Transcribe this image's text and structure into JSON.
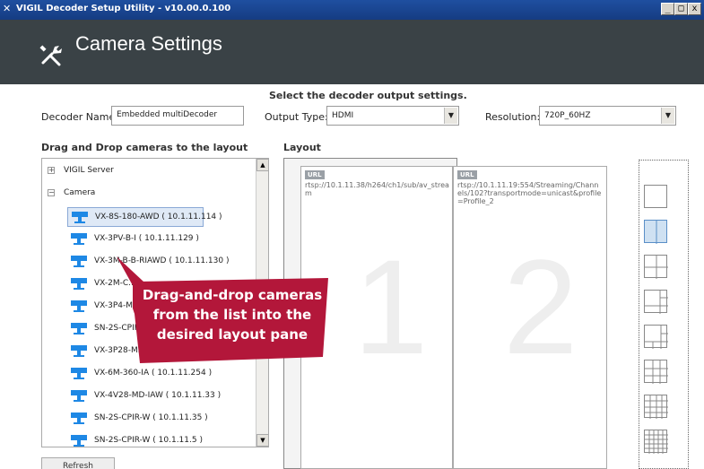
{
  "window": {
    "title": "VIGIL Decoder Setup Utility - v10.00.0.100",
    "minimize_label": "_",
    "maximize_label": "□",
    "close_label": "x"
  },
  "header": {
    "title": "Camera Settings",
    "icon": "wrench-screwdriver-icon"
  },
  "output_settings": {
    "heading": "Select the decoder output settings.",
    "decoder_name_label": "Decoder Name:",
    "decoder_name_value": "Embedded multiDecoder",
    "output_type_label": "Output Type:",
    "output_type_value": "HDMI",
    "resolution_label": "Resolution:",
    "resolution_value": "720P_60HZ"
  },
  "camera_list": {
    "heading": "Drag and Drop cameras to the layout",
    "nodes": [
      {
        "label": "VIGIL Server",
        "expander": "+"
      },
      {
        "label": "Camera",
        "expander": "−"
      }
    ],
    "cameras": [
      {
        "label": "VX-8S-180-AWD ( 10.1.11.114 )",
        "selected": true
      },
      {
        "label": "VX-3PV-B-I ( 10.1.11.129 )"
      },
      {
        "label": "VX-3M-B-B-RIAWD ( 10.1.11.130 )"
      },
      {
        "label": "VX-2M-C..."
      },
      {
        "label": "VX-3P4-MB..."
      },
      {
        "label": "SN-2S-CPIR-W..."
      },
      {
        "label": "VX-3P28-MD-I..."
      },
      {
        "label": "VX-6M-360-IA ( 10.1.11.254 )"
      },
      {
        "label": "VX-4V28-MD-IAW ( 10.1.11.33 )"
      },
      {
        "label": "SN-2S-CPIR-W ( 10.1.11.35 )"
      },
      {
        "label": "SN-2S-CPIR-W ( 10.1.11.5 )"
      }
    ],
    "refresh_label": "Refresh",
    "scroll_up": "▲",
    "scroll_down": "▼"
  },
  "layout": {
    "heading": "Layout",
    "panes": [
      {
        "badge": "URL",
        "url": "rtsp://10.1.11.38/h264/ch1/sub/av_stream",
        "number": "1"
      },
      {
        "badge": "URL",
        "url": "rtsp://10.1.11.19:554/Streaming/Channels/102?transportmode=unicast&profile=Profile_2",
        "number": "2"
      }
    ],
    "options": [
      "1x1",
      "2 vertical",
      "2x2",
      "1+3",
      "1+5",
      "3x3",
      "4x4",
      "5x5"
    ],
    "selected_option": "2 vertical"
  },
  "callout": {
    "line1": "Drag-and-drop cameras",
    "line2": "from the list into the",
    "line3": "desired layout pane",
    "color": "#b3173a"
  },
  "colors": {
    "titlebar": "#1f4fa0",
    "header_bg": "#3a4246",
    "camera_icon": "#1e88e5",
    "selection": "#dfe9f6"
  }
}
